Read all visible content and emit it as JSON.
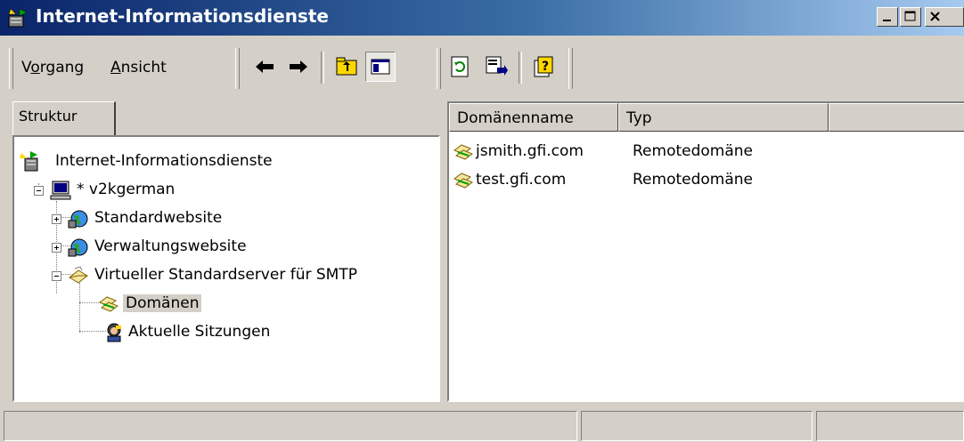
{
  "window": {
    "title": "Internet-Informationsdienste",
    "icon": "iis-app-icon",
    "caption_buttons": [
      "minimize",
      "maximize",
      "close"
    ]
  },
  "toolbar": {
    "menus": [
      {
        "pre": "V",
        "acc": "o",
        "post": "rgang"
      },
      {
        "pre": "",
        "acc": "A",
        "post": "nsicht"
      }
    ],
    "buttons": [
      "back-arrow-icon",
      "forward-arrow-icon",
      "up-folder-icon",
      "show-tree-icon",
      "refresh-icon",
      "export-list-icon",
      "help-icon"
    ]
  },
  "tree": {
    "tab_label": "Struktur",
    "items": [
      {
        "label": "Internet-Informationsdienste",
        "icon": "iis-root-icon"
      },
      {
        "label": "* v2kgerman",
        "icon": "computer-icon"
      },
      {
        "label": "Standardwebsite",
        "icon": "website-icon"
      },
      {
        "label": "Verwaltungswebsite",
        "icon": "website-icon"
      },
      {
        "label": "Virtueller Standardserver für SMTP",
        "icon": "smtp-server-icon"
      },
      {
        "label": "Domänen",
        "icon": "domains-icon",
        "selected": true
      },
      {
        "label": "Aktuelle Sitzungen",
        "icon": "sessions-icon"
      }
    ]
  },
  "list": {
    "columns": [
      "Domänenname",
      "Typ",
      ""
    ],
    "rows": [
      {
        "name": "jsmith.gfi.com",
        "type": "Remotedomäne"
      },
      {
        "name": "test.gfi.com",
        "type": "Remotedomäne"
      }
    ]
  },
  "colors": {
    "titlebar_start": "#0a246a",
    "titlebar_end": "#a6caf0",
    "face": "#d4d0c8"
  }
}
